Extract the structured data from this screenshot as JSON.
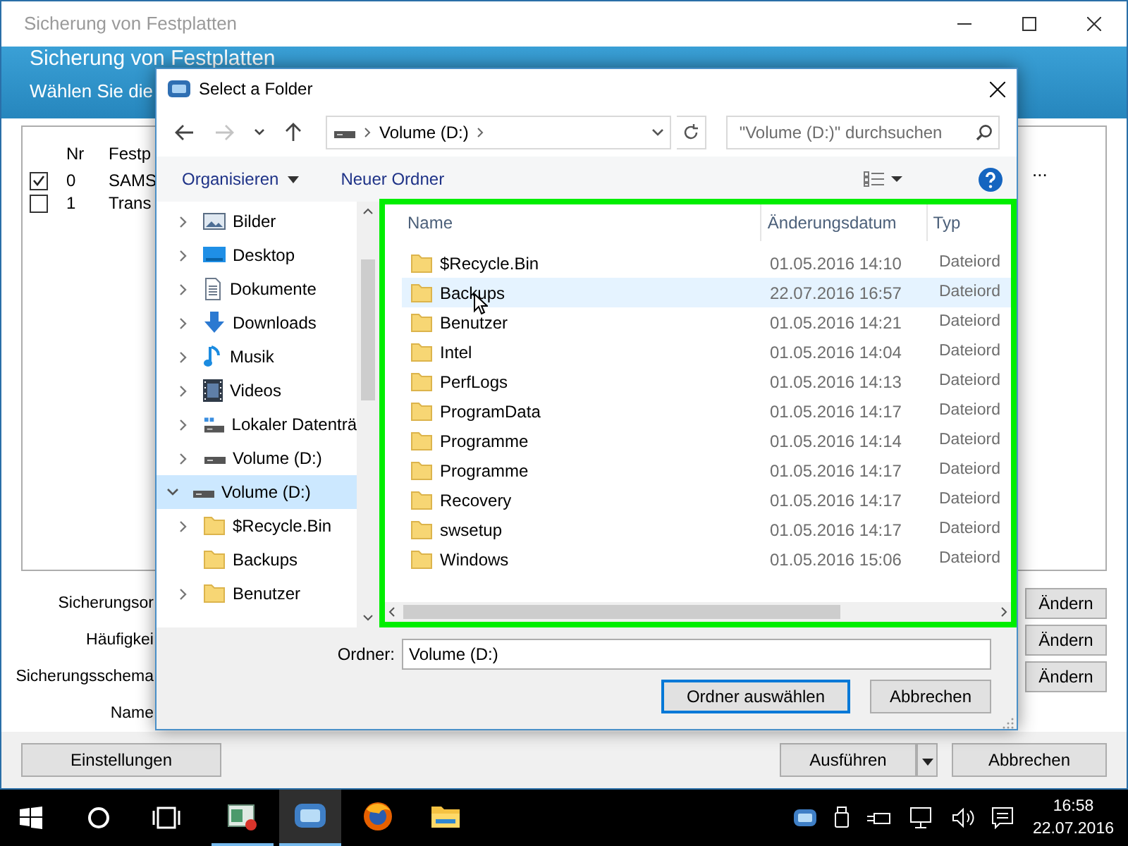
{
  "background_window": {
    "title": "Sicherung von Festplatten",
    "header_title": "Sicherung von Festplatten",
    "header_subtitle": "Wählen Sie die",
    "table": {
      "columns": [
        "Nr",
        "Festp"
      ],
      "rows": [
        {
          "checked": true,
          "nr": "0",
          "name": "SAMS"
        },
        {
          "checked": false,
          "nr": "1",
          "name": "Trans"
        }
      ]
    },
    "more_button": "...",
    "fields": [
      {
        "label": "Sicherungsor",
        "button": "Ändern"
      },
      {
        "label": "Häufigkei",
        "button": "Ändern"
      },
      {
        "label": "Sicherungsschema",
        "button": "Ändern"
      },
      {
        "label": "Name"
      }
    ],
    "buttons": {
      "settings": "Einstellungen",
      "run": "Ausführen",
      "cancel": "Abbrechen"
    }
  },
  "dialog": {
    "title": "Select a Folder",
    "nav_buttons": [
      {
        "kind": "back",
        "disabled": false
      },
      {
        "kind": "forward",
        "disabled": true
      },
      {
        "kind": "recent",
        "disabled": false
      },
      {
        "kind": "up",
        "disabled": false
      }
    ],
    "address": [
      "Volume (D:)"
    ],
    "search": {
      "placeholder": "\"Volume (D:)\" durchsuchen"
    },
    "toolbar": {
      "organize": "Organisieren",
      "new_folder": "Neuer Ordner"
    },
    "tree": [
      {
        "label": "Bilder",
        "kind": "pictures",
        "has_children": true,
        "expanded": false,
        "selected": false
      },
      {
        "label": "Desktop",
        "kind": "desktop",
        "has_children": true,
        "expanded": false,
        "selected": false
      },
      {
        "label": "Dokumente",
        "kind": "documents",
        "has_children": true,
        "expanded": false,
        "selected": false
      },
      {
        "label": "Downloads",
        "kind": "downloads",
        "has_children": true,
        "expanded": false,
        "selected": false
      },
      {
        "label": "Musik",
        "kind": "music",
        "has_children": true,
        "expanded": false,
        "selected": false
      },
      {
        "label": "Videos",
        "kind": "videos",
        "has_children": true,
        "expanded": false,
        "selected": false
      },
      {
        "label": "Lokaler Datenträ",
        "kind": "system-drive",
        "has_children": true,
        "expanded": false,
        "selected": false
      },
      {
        "label": "Volume (D:)",
        "kind": "drive",
        "has_children": true,
        "expanded": false,
        "selected": false
      },
      {
        "label": "Volume (D:)",
        "kind": "drive",
        "has_children": true,
        "expanded": true,
        "selected": true,
        "children": [
          {
            "label": "$Recycle.Bin",
            "kind": "folder",
            "has_children": true,
            "expanded": false,
            "selected": false
          },
          {
            "label": "Backups",
            "kind": "folder",
            "has_children": false,
            "expanded": false,
            "selected": false
          },
          {
            "label": "Benutzer",
            "kind": "folder",
            "has_children": true,
            "expanded": false,
            "selected": false
          }
        ]
      }
    ],
    "list": {
      "columns": [
        "Name",
        "Änderungsdatum",
        "Typ"
      ],
      "rows": [
        {
          "name": "$Recycle.Bin",
          "date": "01.05.2016 14:10",
          "type": "Dateiord",
          "highlighted": false
        },
        {
          "name": "Backups",
          "date": "22.07.2016 16:57",
          "type": "Dateiord",
          "highlighted": true
        },
        {
          "name": "Benutzer",
          "date": "01.05.2016 14:21",
          "type": "Dateiord",
          "highlighted": false
        },
        {
          "name": "Intel",
          "date": "01.05.2016 14:04",
          "type": "Dateiord",
          "highlighted": false
        },
        {
          "name": "PerfLogs",
          "date": "01.05.2016 14:13",
          "type": "Dateiord",
          "highlighted": false
        },
        {
          "name": "ProgramData",
          "date": "01.05.2016 14:17",
          "type": "Dateiord",
          "highlighted": false
        },
        {
          "name": "Programme",
          "date": "01.05.2016 14:14",
          "type": "Dateiord",
          "highlighted": false
        },
        {
          "name": "Programme",
          "date": "01.05.2016 14:17",
          "type": "Dateiord",
          "highlighted": false
        },
        {
          "name": "Recovery",
          "date": "01.05.2016 14:17",
          "type": "Dateiord",
          "highlighted": false
        },
        {
          "name": "swsetup",
          "date": "01.05.2016 14:17",
          "type": "Dateiord",
          "highlighted": false
        },
        {
          "name": "Windows",
          "date": "01.05.2016 15:06",
          "type": "Dateiord",
          "highlighted": false
        }
      ]
    },
    "folder_label": "Ordner:",
    "folder_value": "Volume (D:)",
    "buttons": [
      {
        "label": "Ordner auswählen",
        "kind": "default"
      },
      {
        "label": "Abbrechen",
        "kind": "normal"
      }
    ]
  },
  "taskbar": {
    "apps": [
      {
        "kind": "window-app",
        "running": true,
        "selected": false
      },
      {
        "kind": "backup-app",
        "running": true,
        "selected": true
      },
      {
        "kind": "browser",
        "running": false,
        "selected": false
      },
      {
        "kind": "folder",
        "running": false,
        "selected": false
      }
    ],
    "clock": {
      "time": "16:58",
      "date": "22.07.2016"
    }
  }
}
